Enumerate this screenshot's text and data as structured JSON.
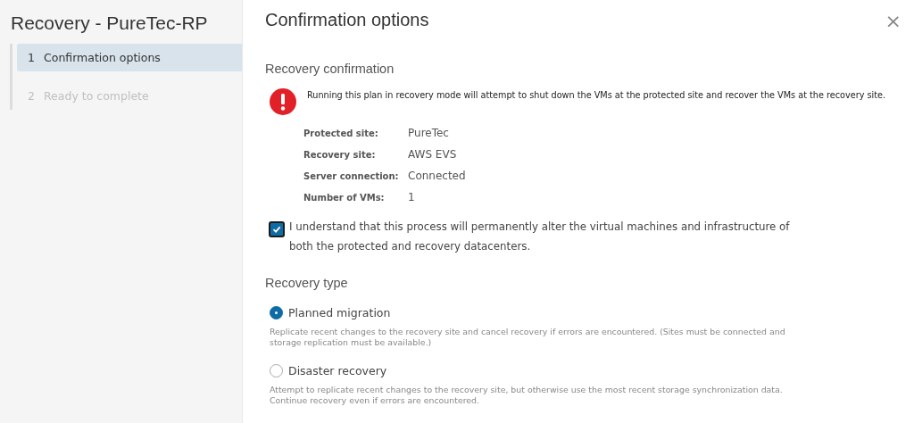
{
  "wizard": {
    "title": "Recovery - PureTec-RP",
    "steps": [
      {
        "number": "1",
        "label": "Confirmation options",
        "selected": true,
        "disabled": false
      },
      {
        "number": "2",
        "label": "Ready to complete",
        "selected": false,
        "disabled": true
      }
    ]
  },
  "page": {
    "title": "Confirmation options",
    "close": "×"
  },
  "confirmation": {
    "heading": "Recovery confirmation",
    "warning": "Running this plan in recovery mode will attempt to shut down the VMs at the protected site and recover the VMs at the recovery site.",
    "details": [
      {
        "label": "Protected site:",
        "value": "PureTec"
      },
      {
        "label": "Recovery site:",
        "value": "AWS EVS"
      },
      {
        "label": "Server connection:",
        "value": "Connected"
      },
      {
        "label": "Number of VMs:",
        "value": "1"
      }
    ],
    "acknowledge": {
      "label": "I understand that this process will permanently alter the virtual machines and infrastructure of both the protected and recovery datacenters.",
      "checked": true
    }
  },
  "recovery_type": {
    "heading": "Recovery type",
    "options": [
      {
        "label": "Planned migration",
        "selected": true,
        "description": "Replicate recent changes to the recovery site and cancel recovery if errors are encountered. (Sites must be connected and storage replication must be available.)"
      },
      {
        "label": "Disaster recovery",
        "selected": false,
        "description": "Attempt to replicate recent changes to the recovery site, but otherwise use the most recent storage synchronization data. Continue recovery even if errors are encountered."
      }
    ]
  }
}
